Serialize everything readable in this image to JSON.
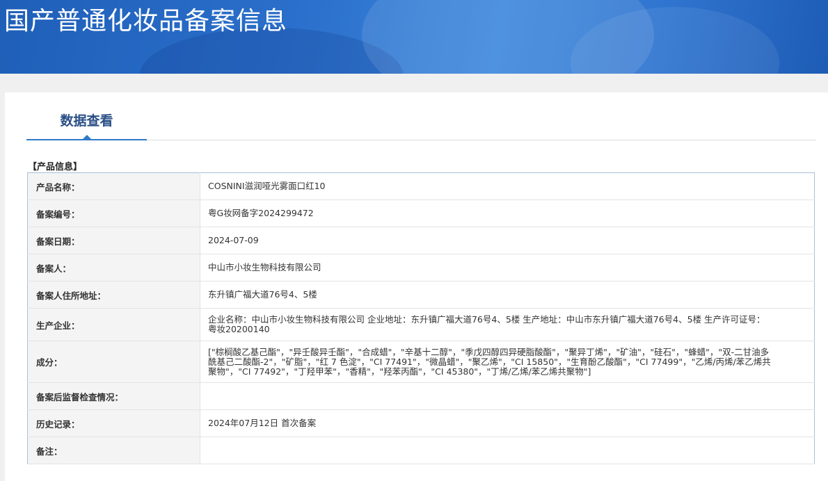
{
  "header": {
    "title": "国产普通化妆品备案信息"
  },
  "tabs": [
    {
      "label": "数据查看"
    }
  ],
  "section": {
    "title": "【产品信息】"
  },
  "product_info": [
    {
      "label": "产品名称：",
      "value": "COSNINI滋润哑光雾面口红10"
    },
    {
      "label": "备案编号：",
      "value": "粤G妆网备字2024299472"
    },
    {
      "label": "备案日期：",
      "value": "2024-07-09"
    },
    {
      "label": "备案人：",
      "value": "中山市小妆生物科技有限公司"
    },
    {
      "label": "备案人住所地址：",
      "value": "东升镇广福大道76号4、5楼"
    },
    {
      "label": "生产企业：",
      "value": "企业名称：中山市小妆生物科技有限公司 企业地址：东升镇广福大道76号4、5楼 生产地址：中山市东升镇广福大道76号4、5楼 生产许可证号：粤妆20200140"
    },
    {
      "label": "成分：",
      "value": "[\"棕榈酸乙基己酯\"，\"异壬酸异壬酯\"，\"合成蜡\"，\"辛基十二醇\"，\"季戊四醇四异硬脂酸酯\"，\"聚异丁烯\"，\"矿油\"，\"硅石\"，\"蜂蜡\"，\"双-二甘油多酰基己二酸酯-2\"，\"矿脂\"，\"红 7 色淀\"，\"CI 77491\"，\"微晶蜡\"，\"聚乙烯\"，\"CI 15850\"，\"生育酚乙酸酯\"，\"CI 77499\"，\"乙烯/丙烯/苯乙烯共聚物\"，\"CI 77492\"，\"丁羟甲苯\"，\"香精\"，\"羟苯丙酯\"，\"CI 45380\"，\"丁烯/乙烯/苯乙烯共聚物\"]"
    },
    {
      "label": "备案后监督检查情况：",
      "value": ""
    },
    {
      "label": "历史记录：",
      "value": "2024年07月12日 首次备案"
    },
    {
      "label": "备注：",
      "value": ""
    }
  ]
}
